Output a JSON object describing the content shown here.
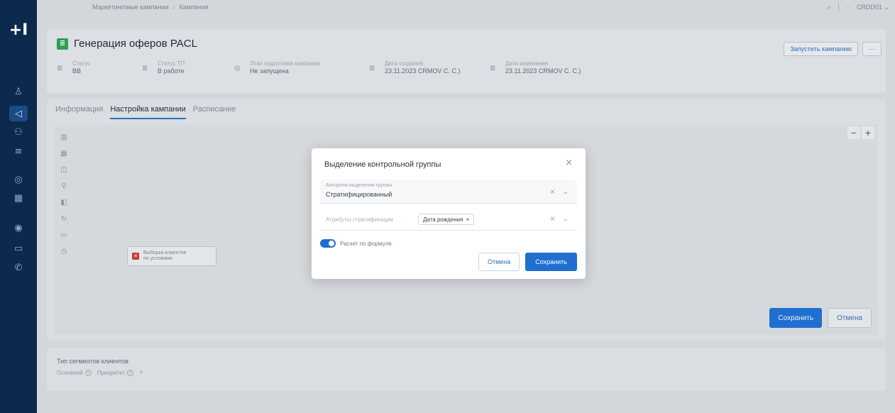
{
  "sidebar": {
    "logo": "+I",
    "icons": [
      "user-icon",
      "megaphone-icon",
      "users-icon",
      "list-icon",
      "globe-icon",
      "grid-icon",
      "target-icon",
      "message-icon",
      "phone-icon"
    ],
    "glyphs": [
      "♙",
      "◁",
      "⚇",
      "≡",
      "◎",
      "▦",
      "◉",
      "▭",
      "✆"
    ]
  },
  "topbar": {
    "breadcrumb": [
      "Маркетинговые кампании",
      "Кампания"
    ],
    "search_glyph": "⌕",
    "bell_glyph": "◌",
    "user_label": "CRDD01 ⌄"
  },
  "header": {
    "title_icon": "≣",
    "title": "Генерация оферов PACL",
    "actions": [
      "Запустить кампанию",
      "⋯"
    ],
    "meta": [
      {
        "icon": "≣",
        "label": "Статус",
        "value": "ВВ"
      },
      {
        "icon": "≣",
        "label": "Статус ТП",
        "value": "В работе"
      },
      {
        "icon": "◎",
        "label": "Этап подготовки кампании",
        "value": "Не запущена"
      },
      {
        "icon": "≣",
        "label": "Дата создания",
        "value": "23.11.2023 CRMOV C. С.)"
      },
      {
        "icon": "≣",
        "label": "Дата изменения",
        "value": "23.11.2023 CRMOV C. С.)"
      }
    ]
  },
  "tabs": [
    "Информация",
    "Настройка кампании",
    "Расписание"
  ],
  "canvas": {
    "tools": [
      "▥",
      "▦",
      "◫",
      "⚲",
      "◧",
      "↻",
      "▭",
      "◷"
    ],
    "zoom_minus": "−",
    "zoom_plus": "+",
    "node_icon": "✕",
    "node_text_1": "Выборка клиентов",
    "node_text_2": "по условиям",
    "save_label": "Сохранить",
    "cancel_label": "Отмена"
  },
  "bottom": {
    "title": "Тип сегментов клиентов",
    "chips": [
      "Основной",
      "Приоритет"
    ],
    "chip_x": "×",
    "add": "+"
  },
  "modal": {
    "title": "Выделение контрольной группы",
    "close": "×",
    "field1_label": "Алгоритм выделения группы",
    "field1_value": "Стратифицированный",
    "field_clear": "×",
    "field_chevron": "⌄",
    "field2_placeholder": "Атрибуты стратификации",
    "field2_chip": "Дата рождения",
    "field2_chip_x": "×",
    "toggle_label": "Расчет по формуле",
    "cancel_label": "Отмена",
    "save_label": "Сохранить"
  }
}
